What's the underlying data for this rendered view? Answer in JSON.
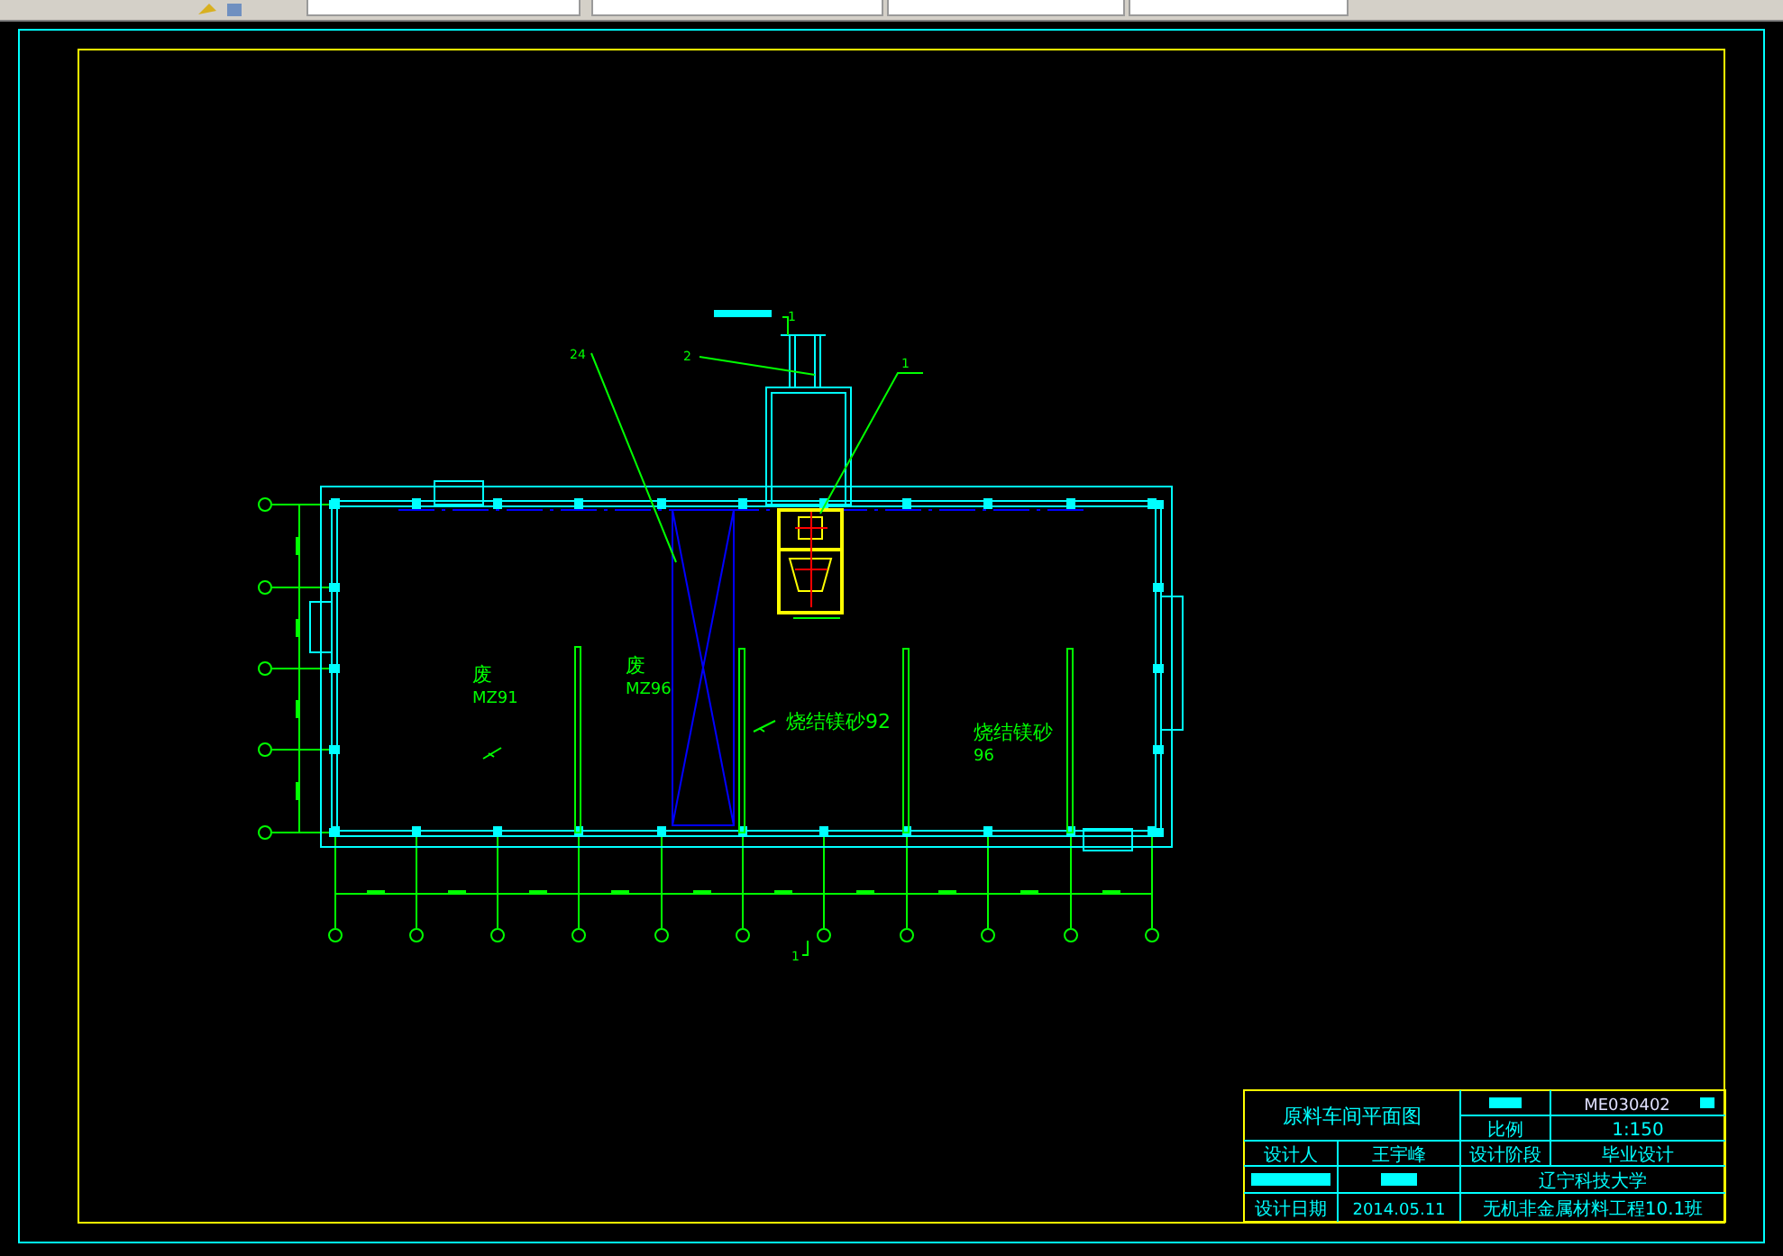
{
  "plan": {
    "room_labels": [
      {
        "line_1": "废",
        "line_2": "MZ91"
      },
      {
        "line_1": "废",
        "line_2": "MZ96"
      },
      {
        "line_1": "烧结镁砂92"
      },
      {
        "line_1": "烧结镁砂",
        "line_2": "96"
      }
    ],
    "leader_labels": [
      "24",
      "2",
      "1"
    ],
    "section_marks": [
      "1",
      "1"
    ]
  },
  "title_block": {
    "drawing_title": "原料车间平面图",
    "drawing_number": "ME030402",
    "scale_label": "比例",
    "scale": "1:150",
    "designer_label": "设计人",
    "designer": "王宇峰",
    "stage_label": "设计阶段",
    "stage": "毕业设计",
    "school": "辽宁科技大学",
    "date_label": "设计日期",
    "date": "2014.05.11",
    "project": "无机非金属材料工程10.1班"
  }
}
